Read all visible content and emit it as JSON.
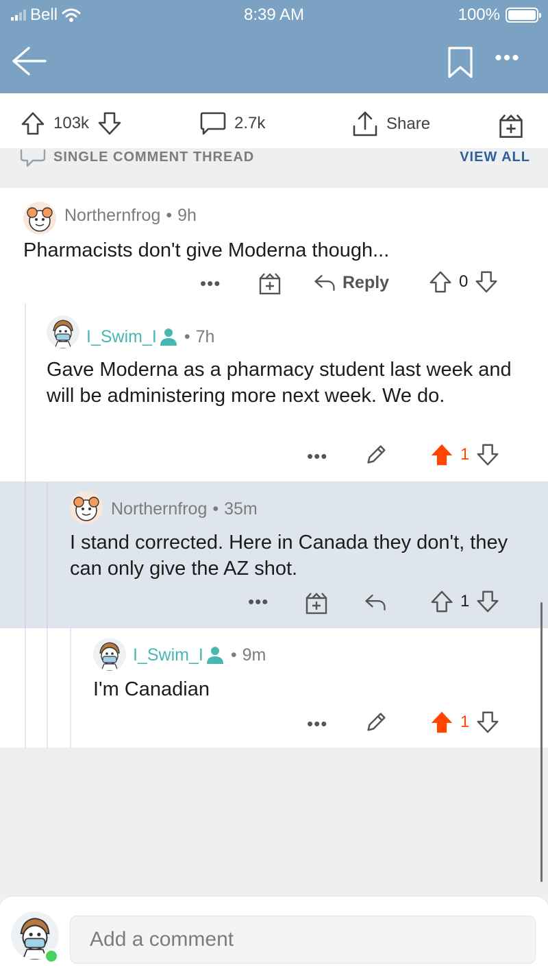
{
  "status_bar": {
    "carrier": "Bell",
    "time": "8:39 AM",
    "battery": "100%"
  },
  "post_actions": {
    "upvotes": "103k",
    "comments": "2.7k",
    "share_label": "Share"
  },
  "thread_header": {
    "label": "SINGLE COMMENT THREAD",
    "view_all": "VIEW ALL"
  },
  "comments": [
    {
      "username": "Northernfrog",
      "age": "9h",
      "body": "Pharmacists don't give Moderna though...",
      "reply_label": "Reply",
      "score": "0"
    },
    {
      "username": "I_Swim_I",
      "age": "7h",
      "body": "Gave Moderna as a pharmacy student last week and will be administering more next week. We do.",
      "score": "1"
    },
    {
      "username": "Northernfrog",
      "age": "35m",
      "body": "I stand corrected. Here in Canada they don't, they can only give the AZ shot.",
      "score": "1"
    },
    {
      "username": "I_Swim_I",
      "age": "9m",
      "body": "I'm Canadian",
      "score": "1"
    }
  ],
  "composer": {
    "placeholder": "Add a comment"
  },
  "colors": {
    "header": "#7ba2c2",
    "upvote": "#ff4500",
    "teal_user": "#46b8b1",
    "highlight": "#dfe5ec"
  },
  "icons": [
    "back-arrow-icon",
    "bookmark-icon",
    "more-icon",
    "upvote-icon",
    "downvote-icon",
    "comment-icon",
    "share-icon",
    "award-icon",
    "edit-icon",
    "reply-icon",
    "user-profile-icon"
  ]
}
